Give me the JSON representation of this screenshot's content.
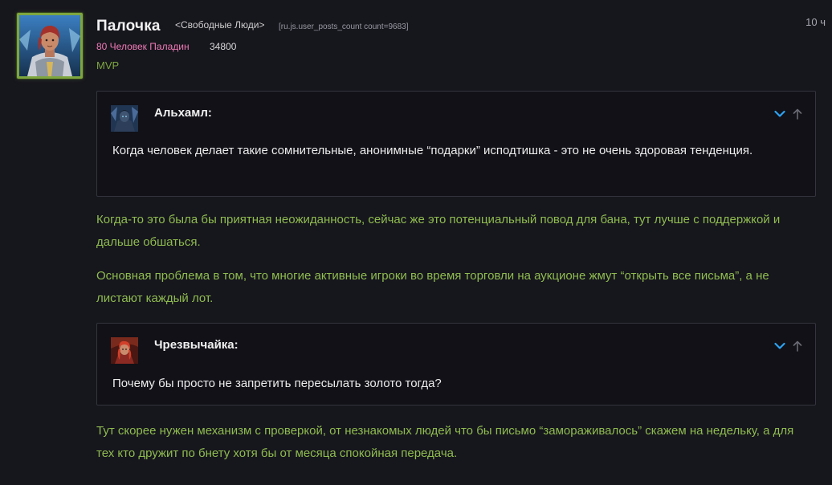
{
  "author": {
    "name": "Палочка",
    "guild": "<Свободные Люди>",
    "posts_count": "[ru.js.user_posts_count count=9683]",
    "char_info": "80 Человек Паладин",
    "achievements": "34800",
    "badge": "MVP"
  },
  "post": {
    "time": "10 ч"
  },
  "quotes": [
    {
      "author": "Альхамл:",
      "text": "Когда человек делает такие сомнительные, анонимные “подарки” исподтишка - это не очень здоровая тенденция."
    },
    {
      "author": "Чрезвычайка:",
      "text": "Почему бы просто не запретить пересылать золото тогда?"
    }
  ],
  "paragraphs": [
    "Когда-то это была бы приятная неожиданность, сейчас же это потенциальный повод для бана, тут лучше с поддержкой и дальше обшаться.",
    "Основная проблема в том, что многие активные игроки во время торговли на аукционе жмут “открыть все письма”, а не листают каждый лот.",
    "Тут скорее нужен механизм с проверкой, от незнакомых людей что бы письмо “замораживалось” скажем на недельку, а для тех кто дружит по бнету хотя бы от месяца спокойная передача."
  ],
  "colors": {
    "background": "#16161d",
    "mvp_green": "#7ea63f",
    "post_text_green": "#8fbc4f",
    "class_pink": "#f07ab5",
    "expand_blue": "#2ea3f2"
  },
  "icons": {
    "expand": "chevron-down-icon",
    "jump": "arrow-up-icon"
  }
}
